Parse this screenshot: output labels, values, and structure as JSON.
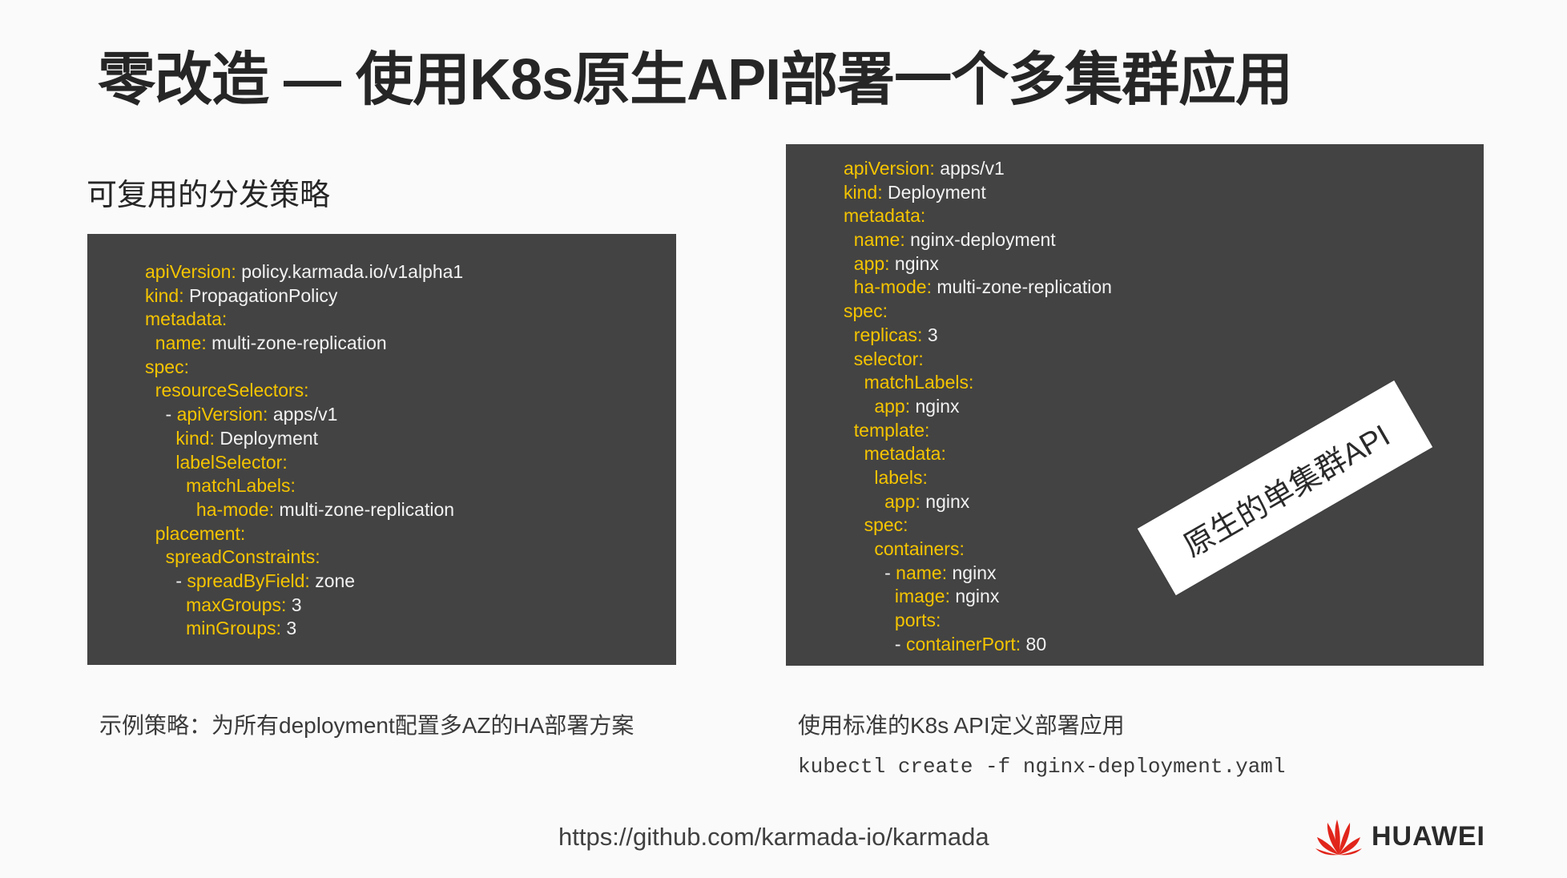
{
  "slide": {
    "title": "零改造 — 使用K8s原生API部署一个多集群应用",
    "left_heading": "可复用的分发策略",
    "left_code": [
      {
        "indent": "",
        "key": "apiVersion",
        "value": " policy.karmada.io/v1alpha1"
      },
      {
        "indent": "",
        "key": "kind",
        "value": " PropagationPolicy"
      },
      {
        "indent": "",
        "key": "metadata",
        "value": ""
      },
      {
        "indent": "  ",
        "key": "name",
        "value": " multi-zone-replication"
      },
      {
        "indent": "",
        "key": "spec",
        "value": ""
      },
      {
        "indent": "  ",
        "key": "resourceSelectors",
        "value": ""
      },
      {
        "indent": "    - ",
        "key": "apiVersion",
        "value": " apps/v1"
      },
      {
        "indent": "      ",
        "key": "kind",
        "value": " Deployment"
      },
      {
        "indent": "      ",
        "key": "labelSelector",
        "value": ""
      },
      {
        "indent": "        ",
        "key": "matchLabels",
        "value": ""
      },
      {
        "indent": "          ",
        "key": "ha-mode",
        "value": " multi-zone-replication"
      },
      {
        "indent": "  ",
        "key": "placement",
        "value": ""
      },
      {
        "indent": "    ",
        "key": "spreadConstraints",
        "value": ""
      },
      {
        "indent": "      - ",
        "key": "spreadByField",
        "value": " zone"
      },
      {
        "indent": "        ",
        "key": "maxGroups",
        "value": " 3"
      },
      {
        "indent": "        ",
        "key": "minGroups",
        "value": " 3"
      }
    ],
    "right_code": [
      {
        "indent": "",
        "key": "apiVersion",
        "value": " apps/v1"
      },
      {
        "indent": "",
        "key": "kind",
        "value": " Deployment"
      },
      {
        "indent": "",
        "key": "metadata",
        "value": ""
      },
      {
        "indent": "  ",
        "key": "name",
        "value": " nginx-deployment"
      },
      {
        "indent": "  ",
        "key": "app",
        "value": " nginx"
      },
      {
        "indent": "  ",
        "key": "ha-mode",
        "value": " multi-zone-replication"
      },
      {
        "indent": "",
        "key": "spec",
        "value": ""
      },
      {
        "indent": "  ",
        "key": "replicas",
        "value": " 3"
      },
      {
        "indent": "  ",
        "key": "selector",
        "value": ""
      },
      {
        "indent": "    ",
        "key": "matchLabels",
        "value": ""
      },
      {
        "indent": "      ",
        "key": "app",
        "value": " nginx"
      },
      {
        "indent": "  ",
        "key": "template",
        "value": ""
      },
      {
        "indent": "    ",
        "key": "metadata",
        "value": ""
      },
      {
        "indent": "      ",
        "key": "labels",
        "value": ""
      },
      {
        "indent": "        ",
        "key": "app",
        "value": " nginx"
      },
      {
        "indent": "    ",
        "key": "spec",
        "value": ""
      },
      {
        "indent": "      ",
        "key": "containers",
        "value": ""
      },
      {
        "indent": "        - ",
        "key": "name",
        "value": " nginx"
      },
      {
        "indent": "          ",
        "key": "image",
        "value": " nginx"
      },
      {
        "indent": "          ",
        "key": "ports",
        "value": ""
      },
      {
        "indent": "          - ",
        "key": "containerPort",
        "value": " 80"
      }
    ],
    "stamp_label": "原生的单集群API",
    "left_caption": "示例策略：为所有deployment配置多AZ的HA部署方案",
    "right_caption": "使用标准的K8s API定义部署应用",
    "command": "kubectl create -f nginx-deployment.yaml",
    "footer_url": "https://github.com/karmada-io/karmada",
    "brand": "HUAWEI",
    "colors": {
      "key": "#f5c400",
      "panel": "#434343",
      "brand_red": "#e1251b"
    }
  }
}
